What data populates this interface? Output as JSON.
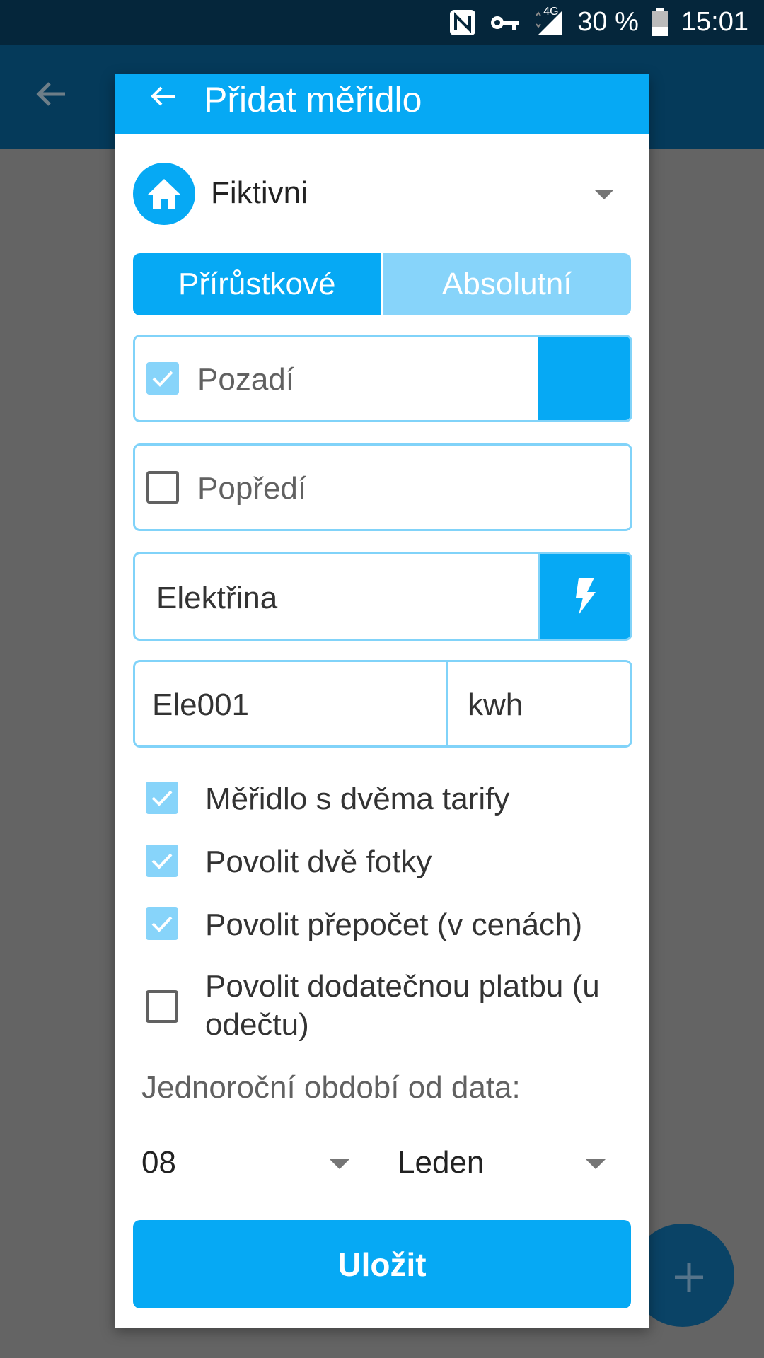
{
  "status_bar": {
    "battery": "30 %",
    "time": "15:01",
    "network": "4G",
    "icons": [
      "nfc-icon",
      "key-icon",
      "signal-icon",
      "battery-icon"
    ]
  },
  "dialog": {
    "title": "Přidat měřidlo",
    "site": {
      "name": "Fiktivni",
      "icon": "home-icon"
    },
    "mode_tabs": [
      {
        "label": "Přírůstkové",
        "active": true
      },
      {
        "label": "Absolutní",
        "active": false
      }
    ],
    "background_option": {
      "label": "Pozadí",
      "checked": true
    },
    "foreground_option": {
      "label": "Popředí",
      "checked": false
    },
    "meter_type": {
      "value": "Elektřina",
      "icon": "lightning-icon"
    },
    "meter_code": {
      "value": "Ele001"
    },
    "meter_unit": {
      "value": "kwh"
    },
    "options": [
      {
        "label": "Měřidlo s dvěma tarify",
        "checked": true
      },
      {
        "label": "Povolit dvě fotky",
        "checked": true
      },
      {
        "label": "Povolit přepočet (v cenách)",
        "checked": true
      },
      {
        "label": "Povolit dodatečnou platbu (u odečtu)",
        "checked": false
      }
    ],
    "period_label": "Jednoroční období od data:",
    "day_select": {
      "value": "08"
    },
    "month_select": {
      "value": "Leden"
    },
    "save_label": "Uložit"
  },
  "colors": {
    "accent": "#06a9f4",
    "accent_light": "#87d4fa",
    "border": "#81d3f9",
    "status_bar": "#05263b",
    "app_bar": "#053a5a",
    "scrim": "#646464"
  }
}
